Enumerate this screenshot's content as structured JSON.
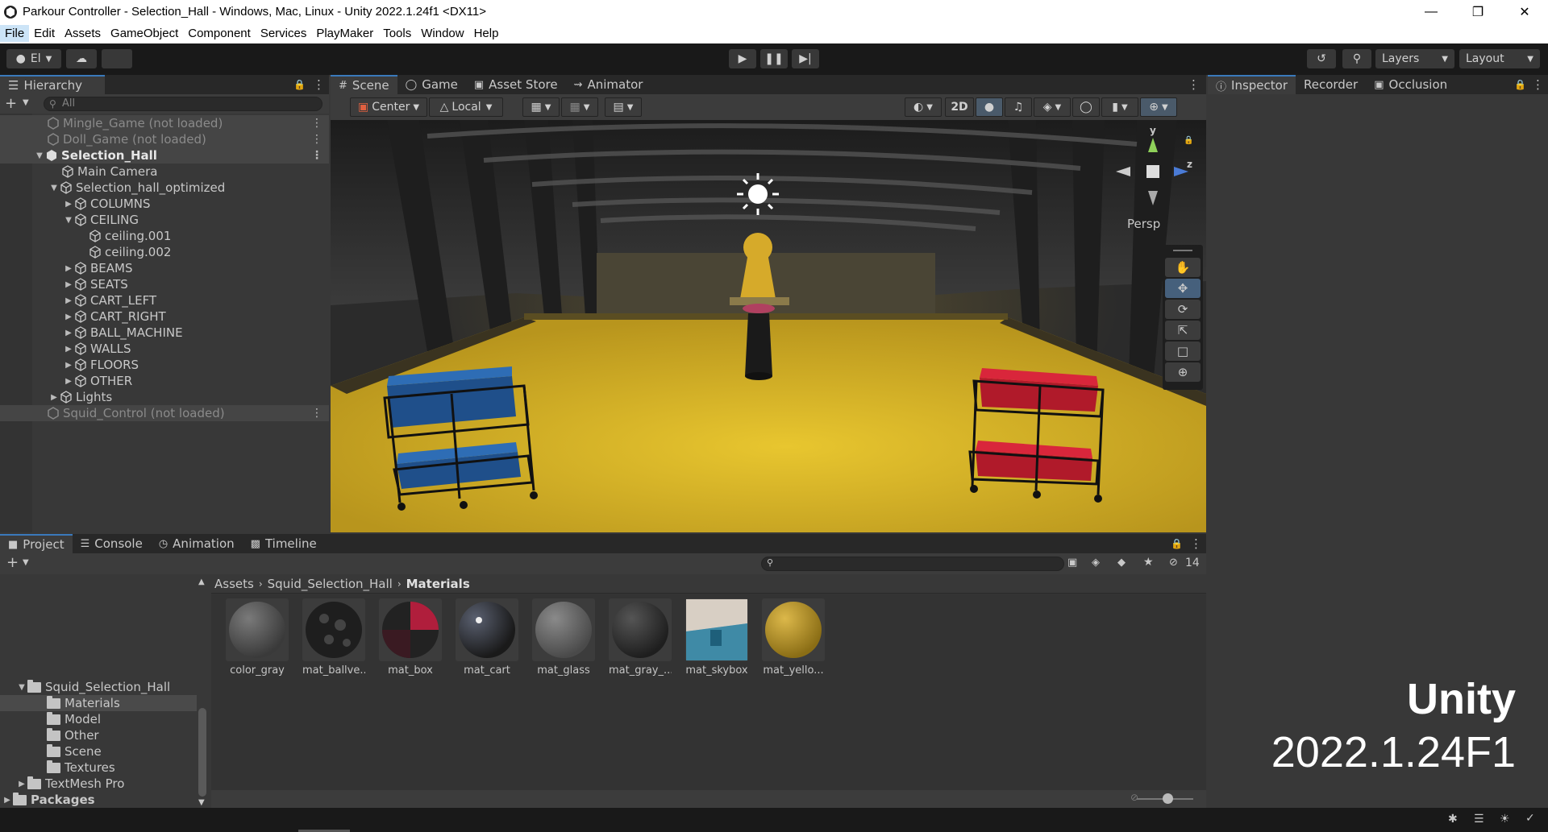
{
  "window": {
    "title": "Parkour Controller - Selection_Hall - Windows, Mac, Linux - Unity 2022.1.24f1 <DX11>"
  },
  "menu": [
    "File",
    "Edit",
    "Assets",
    "GameObject",
    "Component",
    "Services",
    "PlayMaker",
    "Tools",
    "Window",
    "Help"
  ],
  "toolbar": {
    "account": "El",
    "layers": "Layers",
    "layout": "Layout"
  },
  "hierarchy": {
    "tab": "Hierarchy",
    "search_placeholder": "All",
    "rows": [
      {
        "label": "Mingle_Game (not loaded)"
      },
      {
        "label": "Doll_Game (not loaded)"
      },
      {
        "label": "Selection_Hall"
      },
      {
        "label": "Main Camera"
      },
      {
        "label": "Selection_hall_optimized"
      },
      {
        "label": "COLUMNS"
      },
      {
        "label": "CEILING"
      },
      {
        "label": "ceiling.001"
      },
      {
        "label": "ceiling.002"
      },
      {
        "label": "BEAMS"
      },
      {
        "label": "SEATS"
      },
      {
        "label": "CART_LEFT"
      },
      {
        "label": "CART_RIGHT"
      },
      {
        "label": "BALL_MACHINE"
      },
      {
        "label": "WALLS"
      },
      {
        "label": "FLOORS"
      },
      {
        "label": "OTHER"
      },
      {
        "label": "Lights"
      },
      {
        "label": "Squid_Control (not loaded)"
      }
    ]
  },
  "scene": {
    "tabs": [
      "Scene",
      "Game",
      "Asset Store",
      "Animator"
    ],
    "pivot": "Center",
    "space": "Local",
    "mode_2d": "2D",
    "gizmo": {
      "y": "y",
      "z": "z",
      "projection": "Persp"
    }
  },
  "inspector": {
    "tabs": [
      "Inspector",
      "Recorder",
      "Occlusion"
    ]
  },
  "project": {
    "tabs": [
      "Project",
      "Console",
      "Animation",
      "Timeline"
    ],
    "breadcrumb": [
      "Assets",
      "Squid_Selection_Hall",
      "Materials"
    ],
    "hidden_count": "14",
    "folders": [
      {
        "label": "Squid_Selection_Hall"
      },
      {
        "label": "Materials"
      },
      {
        "label": "Model"
      },
      {
        "label": "Other"
      },
      {
        "label": "Scene"
      },
      {
        "label": "Textures"
      },
      {
        "label": "TextMesh Pro"
      },
      {
        "label": "Packages"
      }
    ],
    "materials": [
      {
        "label": "color_gray",
        "color": "#5a5a5a"
      },
      {
        "label": "mat_ballve...",
        "color": "#1e1e1e"
      },
      {
        "label": "mat_box",
        "color": "#b01e3c"
      },
      {
        "label": "mat_cart",
        "color": "#2a2a2a"
      },
      {
        "label": "mat_glass",
        "color": "#6a6a6a"
      },
      {
        "label": "mat_gray_...",
        "color": "#333333"
      },
      {
        "label": "mat_skybox",
        "color": "#7fb2c8"
      },
      {
        "label": "mat_yello...",
        "color": "#c6a233"
      }
    ]
  },
  "watermark": {
    "line1": "Unity",
    "line2": "2022.1.24F1"
  }
}
